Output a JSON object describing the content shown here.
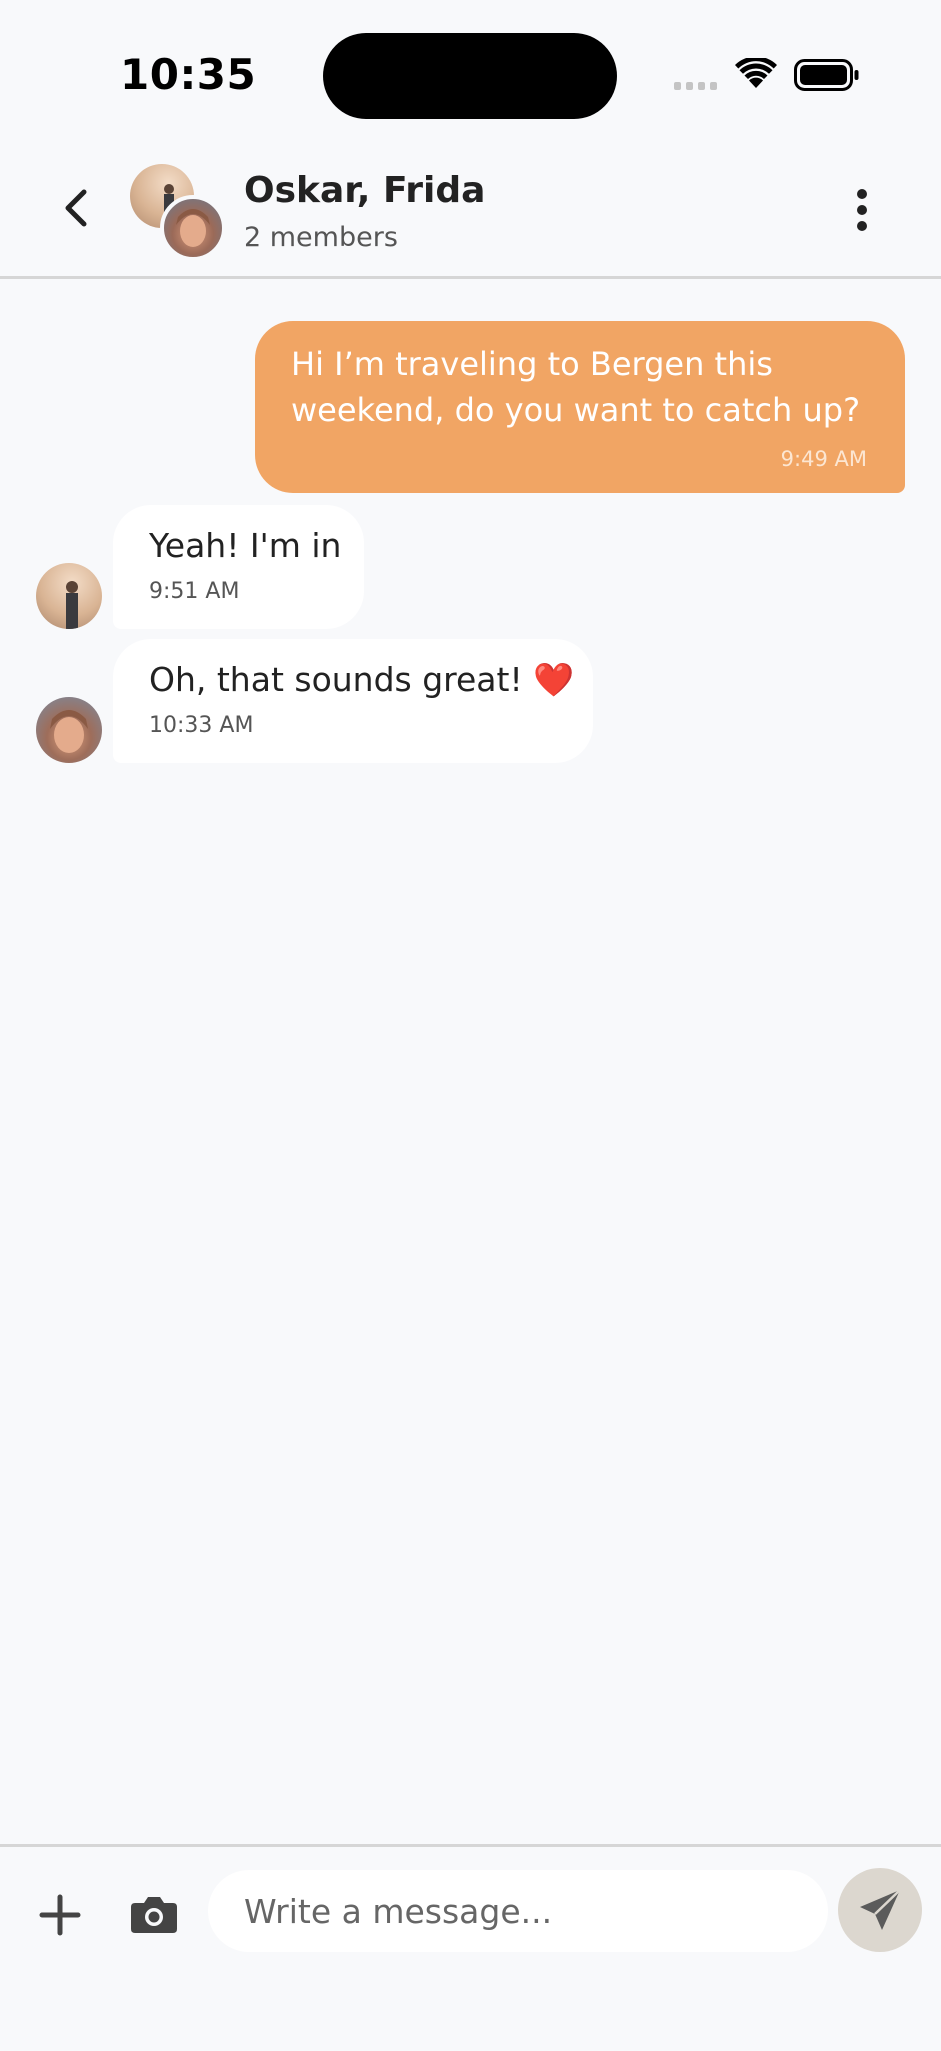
{
  "status_bar": {
    "time": "10:35"
  },
  "header": {
    "title": "Oskar, Frida",
    "subtitle": "2 members",
    "back_icon": "chevron-left-icon",
    "menu_icon": "more-vertical-icon"
  },
  "messages": [
    {
      "direction": "outgoing",
      "text": "Hi I’m traveling to Bergen this weekend, do you want to catch up?",
      "time": "9:49 AM"
    },
    {
      "direction": "incoming",
      "sender": "Oskar",
      "text": "Yeah! I'm in",
      "time": "9:51 AM"
    },
    {
      "direction": "incoming",
      "sender": "Frida",
      "text": "Oh, that sounds great! ❤️",
      "time": "10:33 AM"
    }
  ],
  "composer": {
    "placeholder": "Write a message...",
    "value": "",
    "attach_icon": "plus-icon",
    "camera_icon": "camera-icon",
    "send_icon": "send-icon"
  },
  "colors": {
    "outgoing_bubble": "#f1a564",
    "incoming_bubble": "#ffffff",
    "background": "#f8f9fb",
    "send_button": "#dcd7cf"
  }
}
